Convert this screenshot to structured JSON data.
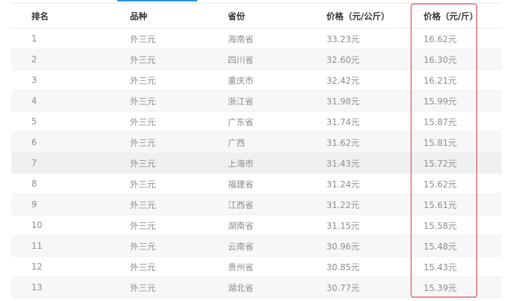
{
  "table": {
    "headers": [
      "排名",
      "品种",
      "省份",
      "价格（元/公斤）",
      "价格（元/斤）"
    ],
    "rows": [
      {
        "rank": "1",
        "variety": "外三元",
        "province": "海南省",
        "price_kg": "33.23元",
        "price_jin": "16.62元"
      },
      {
        "rank": "2",
        "variety": "外三元",
        "province": "四川省",
        "price_kg": "32.60元",
        "price_jin": "16.30元"
      },
      {
        "rank": "3",
        "variety": "外三元",
        "province": "重庆市",
        "price_kg": "32.42元",
        "price_jin": "16.21元"
      },
      {
        "rank": "4",
        "variety": "外三元",
        "province": "浙江省",
        "price_kg": "31.98元",
        "price_jin": "15.99元"
      },
      {
        "rank": "5",
        "variety": "外三元",
        "province": "广东省",
        "price_kg": "31.74元",
        "price_jin": "15.87元"
      },
      {
        "rank": "6",
        "variety": "外三元",
        "province": "广西",
        "price_kg": "31.62元",
        "price_jin": "15.81元"
      },
      {
        "rank": "7",
        "variety": "外三元",
        "province": "上海市",
        "price_kg": "31.43元",
        "price_jin": "15.72元"
      },
      {
        "rank": "8",
        "variety": "外三元",
        "province": "福建省",
        "price_kg": "31.24元",
        "price_jin": "15.62元"
      },
      {
        "rank": "9",
        "variety": "外三元",
        "province": "江西省",
        "price_kg": "31.22元",
        "price_jin": "15.61元"
      },
      {
        "rank": "10",
        "variety": "外三元",
        "province": "湖南省",
        "price_kg": "31.15元",
        "price_jin": "15.58元"
      },
      {
        "rank": "11",
        "variety": "外三元",
        "province": "云南省",
        "price_kg": "30.96元",
        "price_jin": "15.48元"
      },
      {
        "rank": "12",
        "variety": "外三元",
        "province": "贵州省",
        "price_kg": "30.85元",
        "price_jin": "15.43元"
      },
      {
        "rank": "13",
        "variety": "外三元",
        "province": "湖北省",
        "price_kg": "30.77元",
        "price_jin": "15.39元"
      }
    ]
  },
  "colors": {
    "accent": "#2a8fe8",
    "highlight_box": "#d0343c",
    "header_text": "#333333",
    "cell_text": "#8c8c8c"
  }
}
